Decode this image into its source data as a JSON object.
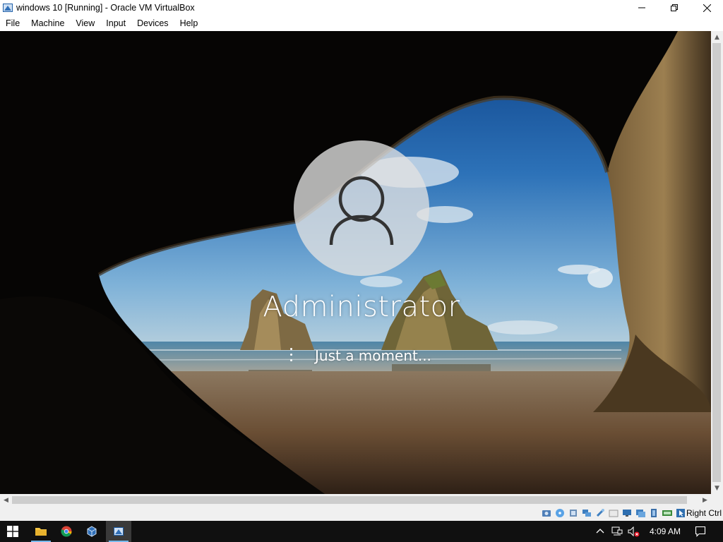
{
  "window": {
    "title": "windows 10 [Running] - Oracle VM VirtualBox",
    "icon": "virtualbox-app-icon",
    "controls": [
      "minimize-icon",
      "restore-icon",
      "close-icon"
    ]
  },
  "menubar": {
    "items": [
      "File",
      "Machine",
      "View",
      "Input",
      "Devices",
      "Help"
    ]
  },
  "guest": {
    "username": "Administrator",
    "status": "Just a moment...",
    "avatar_icon": "user-avatar-icon",
    "background": "windows-10-lock-screen-cave-beach"
  },
  "statusbar": {
    "icons": [
      "hard-disk-icon",
      "optical-drive-icon",
      "audio-icon",
      "network-icon",
      "usb-icon",
      "shared-folders-icon",
      "display-icon",
      "video-capture-icon",
      "cpu-icon",
      "keyboard-capture-icon",
      "mouse-integration-icon"
    ],
    "host_key": "Right Ctrl"
  },
  "taskbar": {
    "apps": [
      "windows-start-icon",
      "file-explorer-icon",
      "chrome-icon",
      "virtualbox-manager-icon",
      "virtualbox-vm-icon"
    ],
    "tray_icons": [
      "show-hidden-icons-icon",
      "network-icon",
      "volume-muted-icon",
      "action-center-icon"
    ],
    "clock": "4:09 AM"
  },
  "colors": {
    "taskbar": "#101010",
    "taskbar_accent": "#76b9ed",
    "chrome_bg": "#ffffff",
    "scrollbar_bg": "#f0f0f0"
  }
}
